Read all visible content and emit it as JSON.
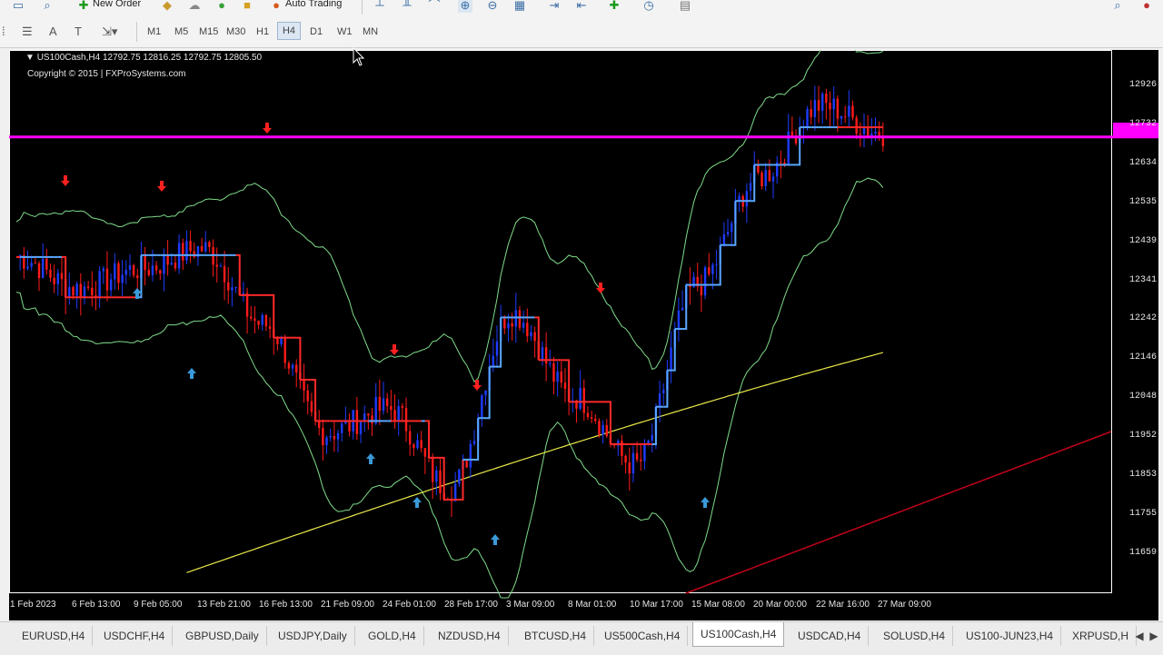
{
  "toolbar": {
    "new_order_label": "New Order",
    "auto_trading_label": "Auto Trading"
  },
  "timeframes": [
    "M1",
    "M5",
    "M15",
    "M30",
    "H1",
    "H4",
    "D1",
    "W1",
    "MN"
  ],
  "active_timeframe": "H4",
  "chart": {
    "symbol_title": "US100Cash,H4  12792.75 12816.25 12792.75 12805.50",
    "copyright": "Copyright © 2015 | FXProSystems.com",
    "y_labels": [
      "12926.90",
      "12732.60",
      "12634.00",
      "12535.40",
      "12439.70",
      "12341.10",
      "12242.50",
      "12146.80",
      "12048.20",
      "11952.50",
      "11853.90",
      "11755.30",
      "11659.60"
    ],
    "x_labels": [
      "1 Feb 2023",
      "6 Feb 13:00",
      "9 Feb 05:00",
      "13 Feb 21:00",
      "16 Feb 13:00",
      "21 Feb 09:00",
      "24 Feb 01:00",
      "28 Feb 17:00",
      "3 Mar 09:00",
      "8 Mar 01:00",
      "10 Mar 17:00",
      "15 Mar 08:00",
      "20 Mar 00:00",
      "22 Mar 16:00",
      "27 Mar 09:00"
    ],
    "colors": {
      "background": "#000000",
      "bull_candle": "#1e3cff",
      "bear_candle": "#ff1a1a",
      "bands": "#7fdc8a",
      "ma": "#e8e84a",
      "horizontal_line": "#ff00ff",
      "trendline": "#c0001a",
      "arrow_up": "#3a9ad9",
      "arrow_down": "#ff2020"
    }
  },
  "tabs": [
    "EURUSD,H4",
    "USDCHF,H4",
    "GBPUSD,Daily",
    "USDJPY,Daily",
    "GOLD,H4",
    "NZDUSD,H4",
    "BTCUSD,H4",
    "US500Cash,H4",
    "US100Cash,H4",
    "USDCAD,H4",
    "SOLUSD,H4",
    "US100-JUN23,H4",
    "XRPUSD,H"
  ],
  "active_tab": "US100Cash,H4",
  "chart_data": {
    "type": "line",
    "title": "US100Cash,H4",
    "x": [
      "1 Feb 2023",
      "6 Feb 13:00",
      "9 Feb 05:00",
      "13 Feb 21:00",
      "16 Feb 13:00",
      "21 Feb 09:00",
      "24 Feb 01:00",
      "28 Feb 17:00",
      "3 Mar 09:00",
      "8 Mar 01:00",
      "10 Mar 17:00",
      "15 Mar 08:00",
      "20 Mar 00:00",
      "22 Mar 16:00",
      "27 Mar 09:00"
    ],
    "series": [
      {
        "values": [
          12500,
          12420,
          12470,
          12520,
          12330,
          12060,
          12120,
          11920,
          12360,
          12150,
          11980,
          12430,
          12700,
          12880,
          12810
        ]
      }
    ],
    "ylim": [
      11659.6,
      12926.9
    ],
    "horizontal_line": 12800
  }
}
